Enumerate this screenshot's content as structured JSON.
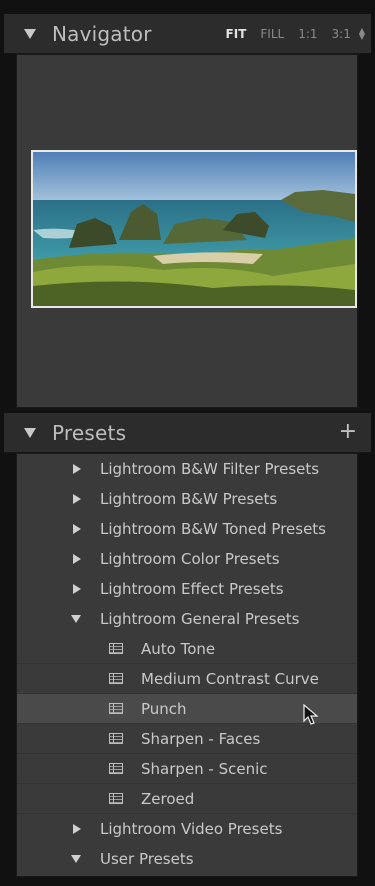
{
  "navigator": {
    "title": "Navigator",
    "zoom_options": [
      "FIT",
      "FILL",
      "1:1",
      "3:1"
    ],
    "active_zoom": "FIT"
  },
  "presets": {
    "title": "Presets",
    "add_icon": "plus-icon",
    "groups": [
      {
        "label": "Lightroom B&W Filter Presets",
        "expanded": false
      },
      {
        "label": "Lightroom B&W Presets",
        "expanded": false
      },
      {
        "label": "Lightroom B&W Toned Presets",
        "expanded": false
      },
      {
        "label": "Lightroom Color Presets",
        "expanded": false
      },
      {
        "label": "Lightroom Effect Presets",
        "expanded": false
      },
      {
        "label": "Lightroom General Presets",
        "expanded": true,
        "items": [
          "Auto Tone",
          "Medium Contrast Curve",
          "Punch",
          "Sharpen - Faces",
          "Sharpen - Scenic",
          "Zeroed"
        ]
      },
      {
        "label": "Lightroom Video Presets",
        "expanded": false
      },
      {
        "label": "User Presets",
        "expanded": true
      }
    ],
    "highlighted_item": "Punch"
  }
}
